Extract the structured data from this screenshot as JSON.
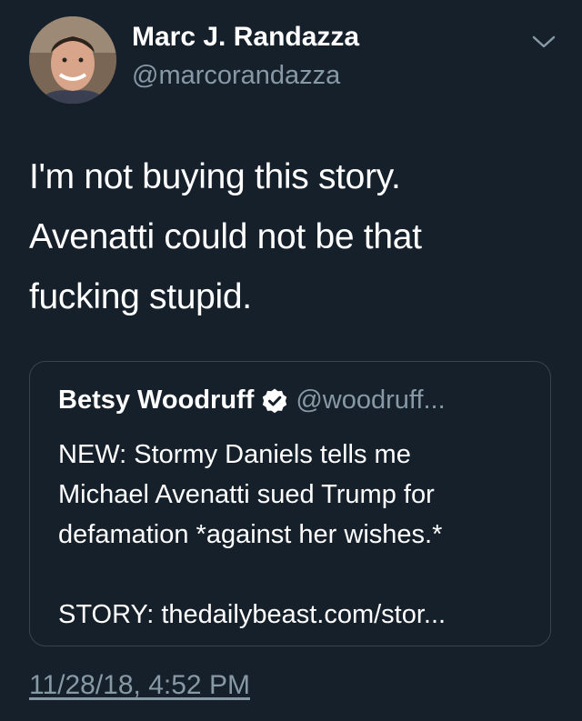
{
  "author": {
    "name": "Marc J. Randazza",
    "handle": "@marcorandazza"
  },
  "icons": {
    "menu": "chevron-down-icon",
    "verified": "verified-badge-icon"
  },
  "tweet": {
    "lines": [
      "I'm not buying this story.",
      "Avenatti could not be that",
      "fucking stupid."
    ],
    "timestamp": "11/28/18, 4:52 PM"
  },
  "quote": {
    "name": "Betsy Woodruff",
    "handle": "@woodruff...",
    "lines": [
      "NEW: Stormy Daniels tells me",
      "Michael Avenatti sued Trump for",
      "defamation *against her wishes.*",
      "",
      "STORY: thedailybeast.com/stor..."
    ]
  },
  "colors": {
    "background": "#15202b",
    "text_primary": "#ffffff",
    "text_secondary": "#8899a6",
    "border": "#38444d"
  }
}
